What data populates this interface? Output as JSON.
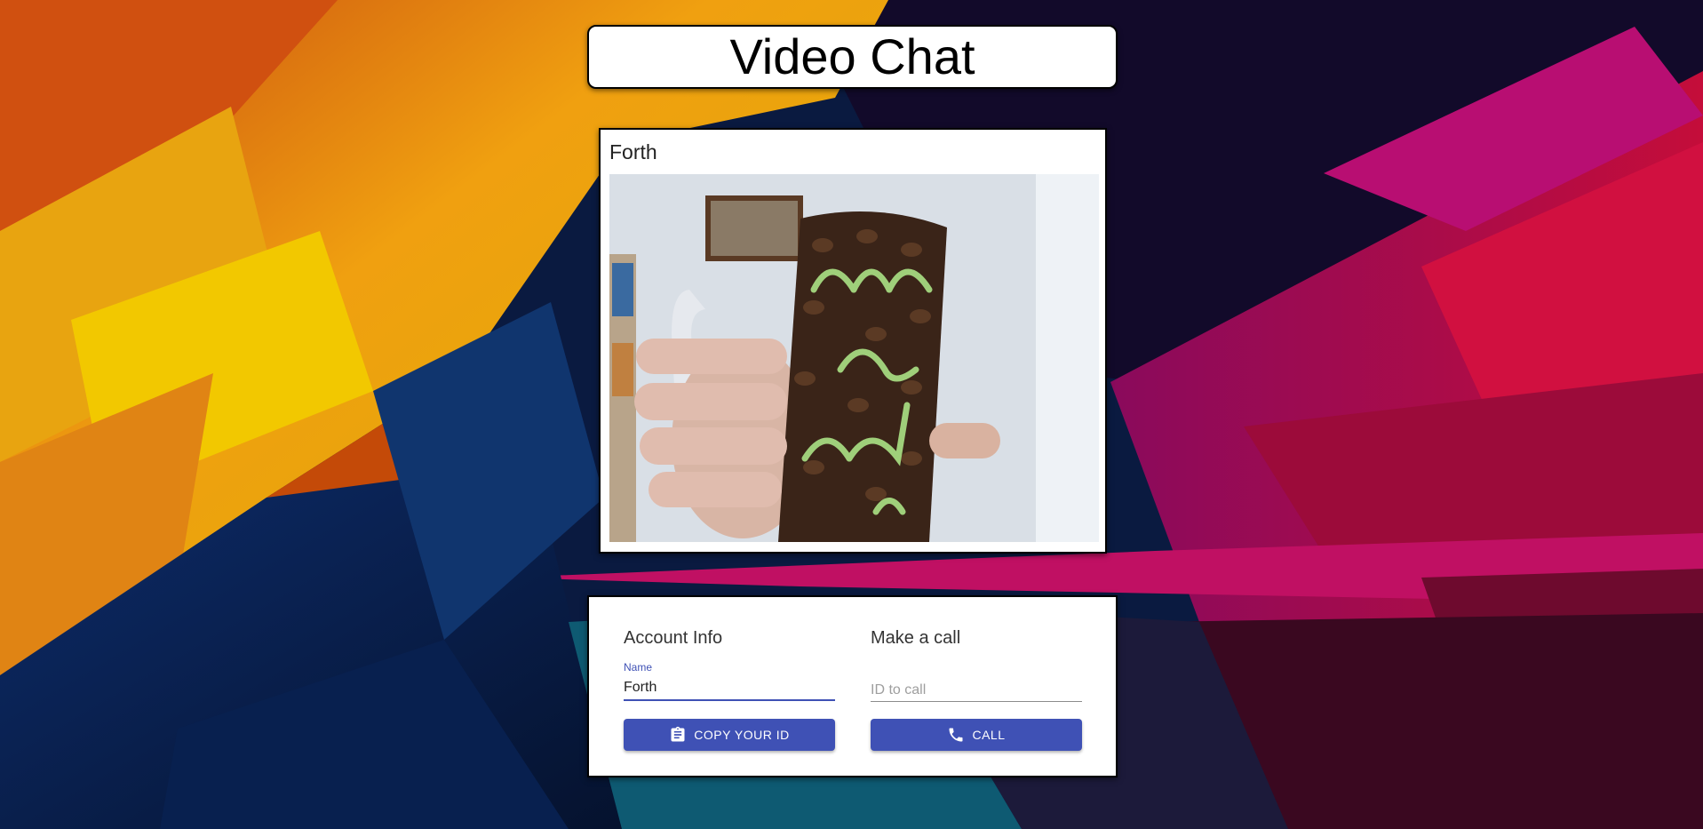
{
  "header": {
    "title": "Video Chat"
  },
  "video": {
    "participant_name": "Forth"
  },
  "account": {
    "heading": "Account Info",
    "name_label": "Name",
    "name_value": "Forth",
    "copy_button_label": "COPY YOUR ID",
    "copy_icon": "clipboard-icon"
  },
  "call": {
    "heading": "Make a call",
    "id_placeholder": "ID to call",
    "call_button_label": "CALL",
    "call_icon": "phone-icon"
  },
  "colors": {
    "primary": "#3f51b5"
  }
}
